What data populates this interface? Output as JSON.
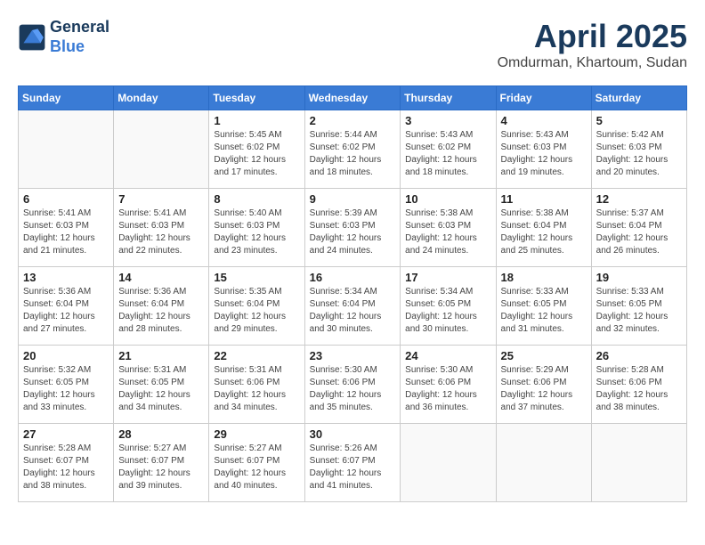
{
  "header": {
    "logo_line1": "General",
    "logo_line2": "Blue",
    "month_year": "April 2025",
    "location": "Omdurman, Khartoum, Sudan"
  },
  "days_of_week": [
    "Sunday",
    "Monday",
    "Tuesday",
    "Wednesday",
    "Thursday",
    "Friday",
    "Saturday"
  ],
  "weeks": [
    [
      {
        "day": "",
        "info": ""
      },
      {
        "day": "",
        "info": ""
      },
      {
        "day": "1",
        "info": "Sunrise: 5:45 AM\nSunset: 6:02 PM\nDaylight: 12 hours and 17 minutes."
      },
      {
        "day": "2",
        "info": "Sunrise: 5:44 AM\nSunset: 6:02 PM\nDaylight: 12 hours and 18 minutes."
      },
      {
        "day": "3",
        "info": "Sunrise: 5:43 AM\nSunset: 6:02 PM\nDaylight: 12 hours and 18 minutes."
      },
      {
        "day": "4",
        "info": "Sunrise: 5:43 AM\nSunset: 6:03 PM\nDaylight: 12 hours and 19 minutes."
      },
      {
        "day": "5",
        "info": "Sunrise: 5:42 AM\nSunset: 6:03 PM\nDaylight: 12 hours and 20 minutes."
      }
    ],
    [
      {
        "day": "6",
        "info": "Sunrise: 5:41 AM\nSunset: 6:03 PM\nDaylight: 12 hours and 21 minutes."
      },
      {
        "day": "7",
        "info": "Sunrise: 5:41 AM\nSunset: 6:03 PM\nDaylight: 12 hours and 22 minutes."
      },
      {
        "day": "8",
        "info": "Sunrise: 5:40 AM\nSunset: 6:03 PM\nDaylight: 12 hours and 23 minutes."
      },
      {
        "day": "9",
        "info": "Sunrise: 5:39 AM\nSunset: 6:03 PM\nDaylight: 12 hours and 24 minutes."
      },
      {
        "day": "10",
        "info": "Sunrise: 5:38 AM\nSunset: 6:03 PM\nDaylight: 12 hours and 24 minutes."
      },
      {
        "day": "11",
        "info": "Sunrise: 5:38 AM\nSunset: 6:04 PM\nDaylight: 12 hours and 25 minutes."
      },
      {
        "day": "12",
        "info": "Sunrise: 5:37 AM\nSunset: 6:04 PM\nDaylight: 12 hours and 26 minutes."
      }
    ],
    [
      {
        "day": "13",
        "info": "Sunrise: 5:36 AM\nSunset: 6:04 PM\nDaylight: 12 hours and 27 minutes."
      },
      {
        "day": "14",
        "info": "Sunrise: 5:36 AM\nSunset: 6:04 PM\nDaylight: 12 hours and 28 minutes."
      },
      {
        "day": "15",
        "info": "Sunrise: 5:35 AM\nSunset: 6:04 PM\nDaylight: 12 hours and 29 minutes."
      },
      {
        "day": "16",
        "info": "Sunrise: 5:34 AM\nSunset: 6:04 PM\nDaylight: 12 hours and 30 minutes."
      },
      {
        "day": "17",
        "info": "Sunrise: 5:34 AM\nSunset: 6:05 PM\nDaylight: 12 hours and 30 minutes."
      },
      {
        "day": "18",
        "info": "Sunrise: 5:33 AM\nSunset: 6:05 PM\nDaylight: 12 hours and 31 minutes."
      },
      {
        "day": "19",
        "info": "Sunrise: 5:33 AM\nSunset: 6:05 PM\nDaylight: 12 hours and 32 minutes."
      }
    ],
    [
      {
        "day": "20",
        "info": "Sunrise: 5:32 AM\nSunset: 6:05 PM\nDaylight: 12 hours and 33 minutes."
      },
      {
        "day": "21",
        "info": "Sunrise: 5:31 AM\nSunset: 6:05 PM\nDaylight: 12 hours and 34 minutes."
      },
      {
        "day": "22",
        "info": "Sunrise: 5:31 AM\nSunset: 6:06 PM\nDaylight: 12 hours and 34 minutes."
      },
      {
        "day": "23",
        "info": "Sunrise: 5:30 AM\nSunset: 6:06 PM\nDaylight: 12 hours and 35 minutes."
      },
      {
        "day": "24",
        "info": "Sunrise: 5:30 AM\nSunset: 6:06 PM\nDaylight: 12 hours and 36 minutes."
      },
      {
        "day": "25",
        "info": "Sunrise: 5:29 AM\nSunset: 6:06 PM\nDaylight: 12 hours and 37 minutes."
      },
      {
        "day": "26",
        "info": "Sunrise: 5:28 AM\nSunset: 6:06 PM\nDaylight: 12 hours and 38 minutes."
      }
    ],
    [
      {
        "day": "27",
        "info": "Sunrise: 5:28 AM\nSunset: 6:07 PM\nDaylight: 12 hours and 38 minutes."
      },
      {
        "day": "28",
        "info": "Sunrise: 5:27 AM\nSunset: 6:07 PM\nDaylight: 12 hours and 39 minutes."
      },
      {
        "day": "29",
        "info": "Sunrise: 5:27 AM\nSunset: 6:07 PM\nDaylight: 12 hours and 40 minutes."
      },
      {
        "day": "30",
        "info": "Sunrise: 5:26 AM\nSunset: 6:07 PM\nDaylight: 12 hours and 41 minutes."
      },
      {
        "day": "",
        "info": ""
      },
      {
        "day": "",
        "info": ""
      },
      {
        "day": "",
        "info": ""
      }
    ]
  ]
}
